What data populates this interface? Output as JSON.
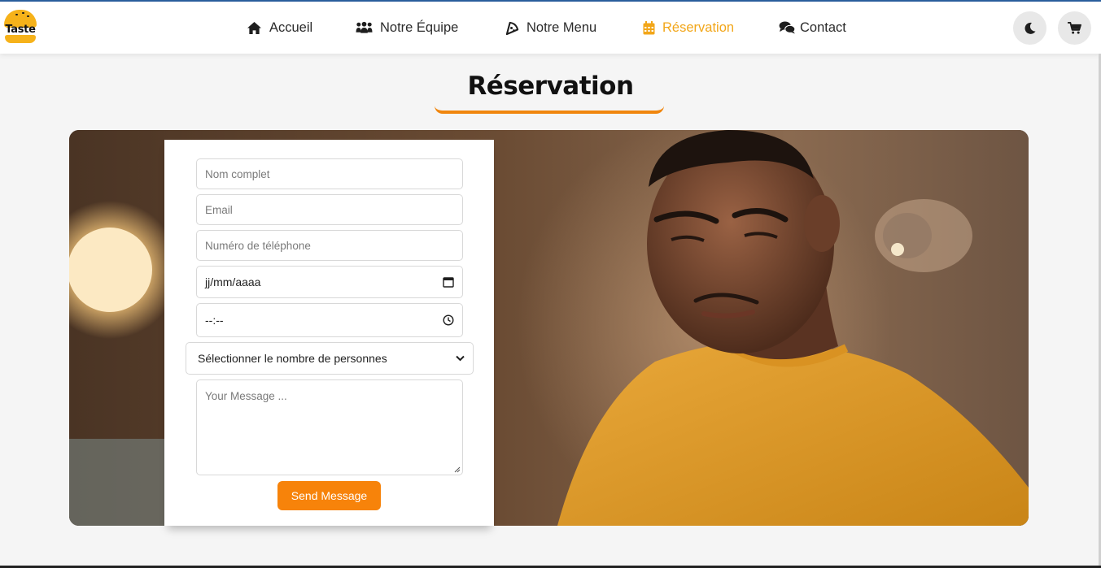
{
  "brand": {
    "logo_text": "Taste"
  },
  "nav": {
    "items": [
      {
        "label": "Accueil",
        "icon": "home-icon",
        "active": false
      },
      {
        "label": "Notre Équipe",
        "icon": "users-icon",
        "active": false
      },
      {
        "label": "Notre Menu",
        "icon": "pizza-icon",
        "active": false
      },
      {
        "label": "Réservation",
        "icon": "calendar-icon",
        "active": true
      },
      {
        "label": "Contact",
        "icon": "comments-icon",
        "active": false
      }
    ],
    "theme_toggle_icon": "moon-icon",
    "cart_icon": "cart-icon"
  },
  "page": {
    "title": "Réservation"
  },
  "form": {
    "name_placeholder": "Nom complet",
    "email_placeholder": "Email",
    "phone_placeholder": "Numéro de téléphone",
    "date_value": "jj/mm/aaaa",
    "time_value": "--:--",
    "guests_selected": "Sélectionner le nombre de personnes",
    "message_placeholder": "Your Message ...",
    "submit_label": "Send Message"
  },
  "colors": {
    "accent": "#f7830a",
    "active_nav": "#f2a619",
    "logo": "#f6b21a"
  }
}
